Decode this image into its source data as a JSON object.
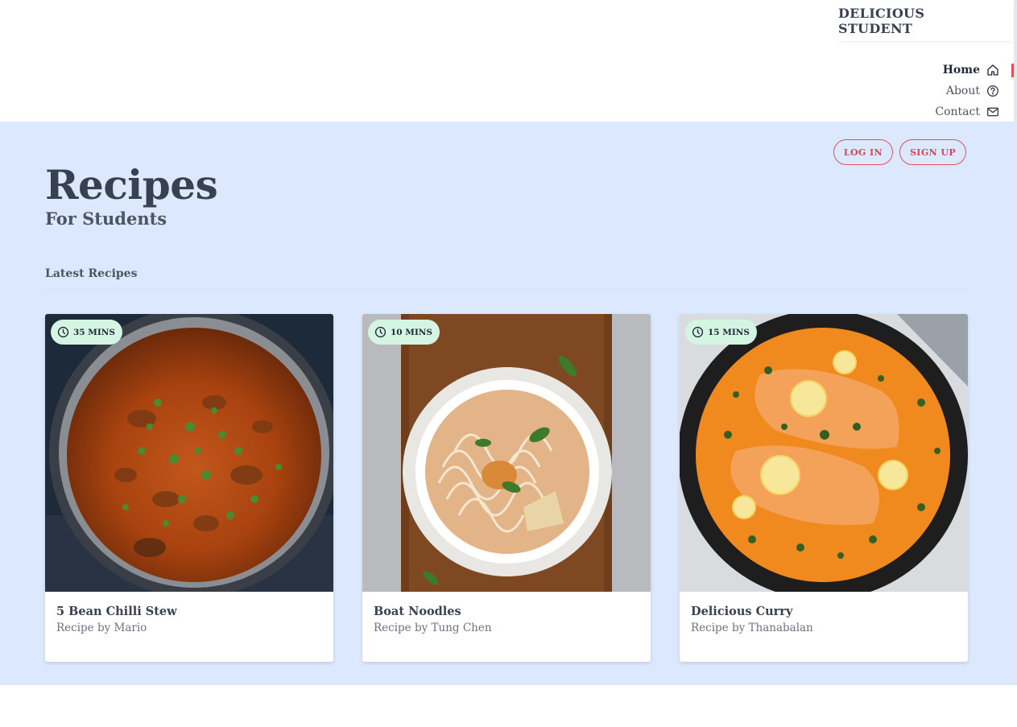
{
  "brand": "DELICIOUS STUDENT",
  "nav": {
    "items": [
      {
        "label": "Home",
        "icon": "home-icon",
        "active": true
      },
      {
        "label": "About",
        "icon": "question-circle-icon",
        "active": false
      },
      {
        "label": "Contact",
        "icon": "envelope-icon",
        "active": false
      }
    ]
  },
  "auth": {
    "login_label": "LOG IN",
    "signup_label": "SIGN UP"
  },
  "hero": {
    "title": "Recipes",
    "subtitle": "For Students"
  },
  "section": {
    "heading": "Latest Recipes"
  },
  "recipes": [
    {
      "time": "35 MINS",
      "title": "5 Bean Chilli Stew",
      "author": "Recipe by Mario",
      "image": "chilli-stew-photo"
    },
    {
      "time": "10 MINS",
      "title": "Boat Noodles",
      "author": "Recipe by Tung Chen",
      "image": "boat-noodles-photo"
    },
    {
      "time": "15 MINS",
      "title": "Delicious Curry",
      "author": "Recipe by Thanabalan",
      "image": "salmon-curry-photo"
    }
  ],
  "colors": {
    "accent": "#e05260",
    "hero_bg": "#dbe8fd",
    "badge_bg": "#d4f5e2",
    "text": "#374151"
  }
}
